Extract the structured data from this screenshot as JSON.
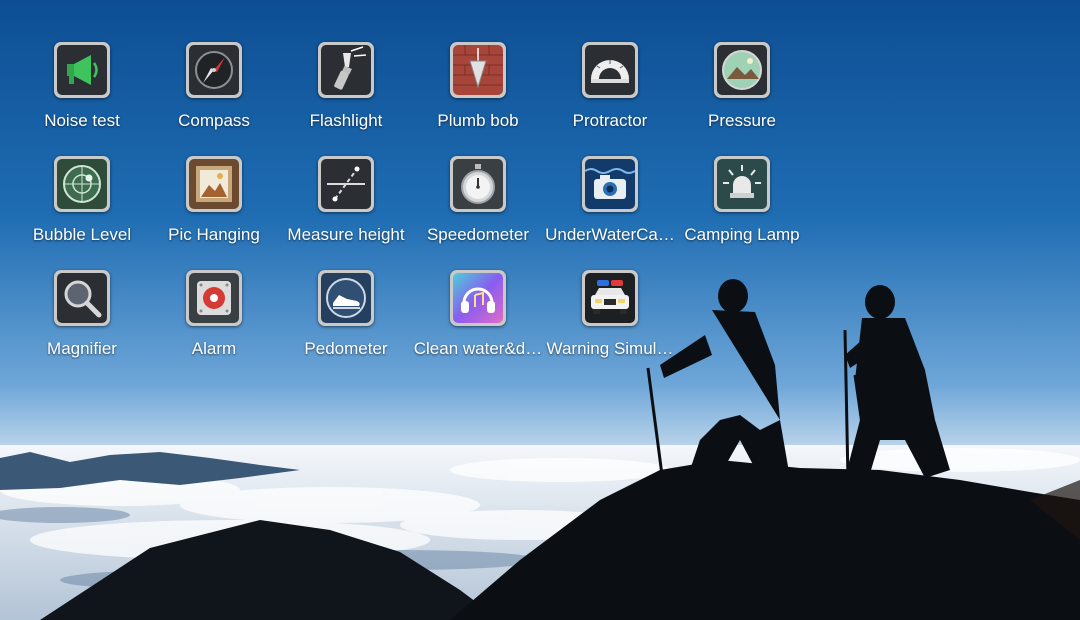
{
  "apps": [
    {
      "label": "Noise test",
      "icon": "megaphone-icon"
    },
    {
      "label": "Compass",
      "icon": "compass-icon"
    },
    {
      "label": "Flashlight",
      "icon": "flashlight-icon"
    },
    {
      "label": "Plumb bob",
      "icon": "plumb-bob-icon"
    },
    {
      "label": "Protractor",
      "icon": "protractor-icon"
    },
    {
      "label": "Pressure",
      "icon": "pressure-icon"
    },
    {
      "label": "Bubble Level",
      "icon": "bubble-level-icon"
    },
    {
      "label": "Pic Hanging",
      "icon": "picture-frame-icon"
    },
    {
      "label": "Measure height",
      "icon": "measure-height-icon"
    },
    {
      "label": "Speedometer",
      "icon": "stopwatch-icon"
    },
    {
      "label": "UnderWaterCa…",
      "icon": "underwater-camera-icon"
    },
    {
      "label": "Camping Lamp",
      "icon": "lamp-icon"
    },
    {
      "label": "Magnifier",
      "icon": "magnifier-icon"
    },
    {
      "label": "Alarm",
      "icon": "alarm-icon"
    },
    {
      "label": "Pedometer",
      "icon": "shoe-icon"
    },
    {
      "label": "Clean water&d…",
      "icon": "headphones-icon"
    },
    {
      "label": "Warning Simul…",
      "icon": "police-car-icon"
    }
  ]
}
